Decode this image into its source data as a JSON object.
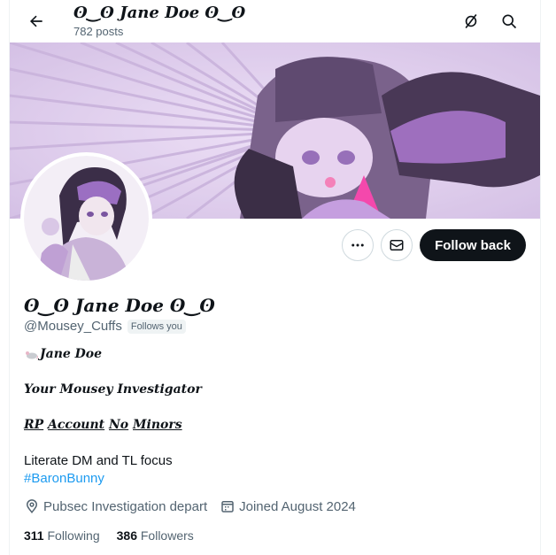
{
  "header": {
    "display_name": "ʘ‿ʘ Jane Doe ʘ‿ʘ",
    "posts_count": "782 posts"
  },
  "profile": {
    "display_name": "ʘ‿ʘ Jane Doe ʘ‿ʘ",
    "handle": "@Mousey_Cuffs",
    "follows_you_label": "Follows you"
  },
  "actions": {
    "follow_back_label": "Follow back"
  },
  "bio": {
    "line1": "Jane Doe",
    "line2": "Your Mousey Investigator",
    "line3_words": [
      "RP",
      "Account",
      "No",
      "Minors"
    ],
    "line4": "Literate DM and TL focus",
    "hashtag": "#BaronBunny"
  },
  "meta": {
    "location": "Pubsec Investigation depart",
    "joined": "Joined August 2024"
  },
  "stats": {
    "following_count": "311",
    "following_label": "Following",
    "followers_count": "386",
    "followers_label": "Followers"
  },
  "icons": {
    "back": "arrow-left-icon",
    "grok": "grok-icon",
    "search": "search-icon",
    "more": "more-dots-icon",
    "message": "envelope-icon",
    "location": "location-pin-icon",
    "calendar": "calendar-icon",
    "mouse": "mouse-icon"
  },
  "colors": {
    "accent": "#1d9bf0",
    "text": "#0f1419",
    "muted": "#536471",
    "banner_tint": "#c08ae6"
  }
}
